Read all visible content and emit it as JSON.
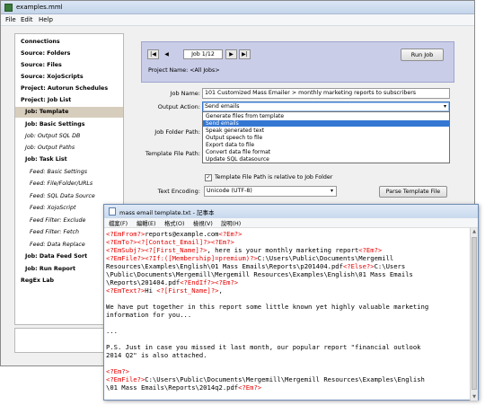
{
  "main_window": {
    "title": "examples.mml",
    "menu": [
      "File",
      "Edit",
      "Help"
    ]
  },
  "sidebar": {
    "items": [
      {
        "label": "Connections",
        "style": "bold"
      },
      {
        "label": "Source: Folders",
        "style": "bold"
      },
      {
        "label": "Source: Files",
        "style": "bold"
      },
      {
        "label": "Source: XojoScripts",
        "style": "bold"
      },
      {
        "label": "Project: Autorun Schedules",
        "style": "bold"
      },
      {
        "label": "Project: Job List",
        "style": "bold"
      },
      {
        "label": "Job: Template",
        "style": "bold",
        "selected": true
      },
      {
        "label": "Job: Basic Settings",
        "style": "bold"
      },
      {
        "label": "Job: Output SQL DB",
        "style": "italic"
      },
      {
        "label": "Job: Output Paths",
        "style": "italic"
      },
      {
        "label": "Job: Task List",
        "style": "bold"
      },
      {
        "label": "Feed: Basic Settings",
        "style": "italic"
      },
      {
        "label": "Feed: File/Folder/URLs",
        "style": "italic"
      },
      {
        "label": "Feed: SQL Data Source",
        "style": "italic"
      },
      {
        "label": "Feed: XojoScript",
        "style": "italic"
      },
      {
        "label": "Feed Filter: Exclude",
        "style": "italic"
      },
      {
        "label": "Feed Filter: Fetch",
        "style": "italic"
      },
      {
        "label": "Feed: Data Replace",
        "style": "italic"
      },
      {
        "label": "Job: Data Feed Sort",
        "style": "bold"
      },
      {
        "label": "Job: Run Report",
        "style": "bold"
      },
      {
        "label": "RegEx Lab",
        "style": "bold"
      }
    ]
  },
  "job_toolbar": {
    "first_glyph": "|◀",
    "prev_glyph": "◀",
    "job_counter": "Job 1/12",
    "next_glyph": "▶",
    "last_glyph": "▶|",
    "run_button": "Run Job",
    "project_name": "Project Name: <All Jobs>"
  },
  "form": {
    "job_name_label": "Job Name:",
    "job_name_value": "101 Customized Mass Emailer > monthly marketing reports to subscribers",
    "output_action_label": "Output Action:",
    "output_action_value": "Send emails",
    "output_action_options": [
      "Generate files from template",
      "Send emails",
      "Speak generated text",
      "Output speech to file",
      "Export data to file",
      "Convert data file format",
      "Update SQL datasource"
    ],
    "job_folder_label": "Job Folder Path:",
    "template_file_label": "Template File Path:",
    "relative_checkbox_label": "Template File Path is relative to Job Folder",
    "relative_checked": true,
    "checkbox_glyph": "✓",
    "dropdown_arrow": "▾",
    "text_encoding_label": "Text Encoding:",
    "text_encoding_value": "Unicode (UTF-8)",
    "parse_button": "Parse Template File"
  },
  "notepad": {
    "title": "mass email template.txt - 記事本",
    "menu": [
      "檔案(F)",
      "編輯(E)",
      "格式(O)",
      "檢視(V)",
      "說明(H)"
    ],
    "scroll_up": "▲",
    "scroll_down": "▼",
    "lines": [
      [
        {
          "t": "<?EmFrom?>",
          "tag": true
        },
        {
          "t": "reports@example.com"
        },
        {
          "t": "<?Em?>",
          "tag": true
        }
      ],
      [
        {
          "t": "<?EmTo?><?[Contact_Email]?>",
          "tag": true
        },
        {
          "t": "<?Em?>",
          "tag": true
        }
      ],
      [
        {
          "t": "<?EmSubj?><?[First_Name]?>",
          "tag": true
        },
        {
          "t": ", here is your monthly marketing report"
        },
        {
          "t": "<?Em?>",
          "tag": true
        }
      ],
      [
        {
          "t": "<?EmFile?><?If:([Membership]=premium)?>",
          "tag": true
        },
        {
          "t": "C:\\Users\\Public\\Documents\\Mergemill"
        }
      ],
      [
        {
          "t": "Resources\\Examples\\English\\01 Mass Emails\\Reports\\p201404.pdf"
        },
        {
          "t": "<?Else?>",
          "tag": true
        },
        {
          "t": "C:\\Users"
        }
      ],
      [
        {
          "t": "\\Public\\Documents\\Mergemill\\Mergemill Resources\\Examples\\English\\01 Mass Emails"
        }
      ],
      [
        {
          "t": "\\Reports\\201404.pdf"
        },
        {
          "t": "<?EndIf?><?Em?>",
          "tag": true
        }
      ],
      [
        {
          "t": "<?EmText?>",
          "tag": true
        },
        {
          "t": "Hi "
        },
        {
          "t": "<?[First_Name]?>",
          "tag": true
        },
        {
          "t": ","
        }
      ],
      [],
      [
        {
          "t": "We have put together in this report some little known yet highly valuable marketing"
        }
      ],
      [
        {
          "t": "information for you..."
        }
      ],
      [],
      [
        {
          "t": "..."
        }
      ],
      [],
      [
        {
          "t": "P.S. Just in case you missed it last month, our popular report \"financial outlook"
        }
      ],
      [
        {
          "t": "2014 Q2\" is also attached."
        }
      ],
      [],
      [
        {
          "t": "<?Em?>",
          "tag": true
        }
      ],
      [
        {
          "t": "<?EmFile?>",
          "tag": true
        },
        {
          "t": "C:\\Users\\Public\\Documents\\Mergemill\\Mergemill Resources\\Examples\\English"
        }
      ],
      [
        {
          "t": "\\01 Mass Emails\\Reports\\2014q2.pdf"
        },
        {
          "t": "<?Em?>",
          "tag": true
        }
      ]
    ]
  }
}
